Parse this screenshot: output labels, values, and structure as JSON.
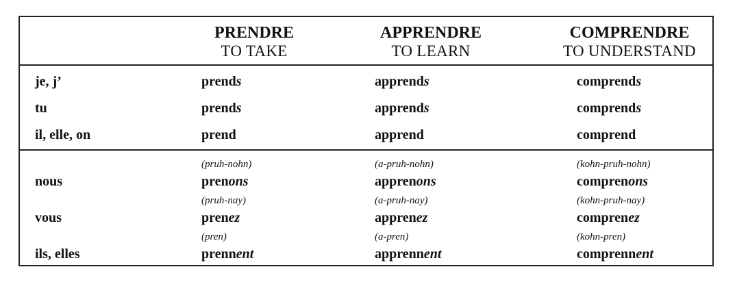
{
  "headers": [
    {
      "verb": "PRENDRE",
      "translation": "TO TAKE"
    },
    {
      "verb": "APPRENDRE",
      "translation": "TO LEARN"
    },
    {
      "verb": "COMPRENDRE",
      "translation": "TO UNDERSTAND"
    }
  ],
  "singular": [
    {
      "subject": "je, j’",
      "forms": [
        {
          "stem": "prend",
          "ending": "s"
        },
        {
          "stem": "apprend",
          "ending": "s"
        },
        {
          "stem": "comprend",
          "ending": "s"
        }
      ]
    },
    {
      "subject": "tu",
      "forms": [
        {
          "stem": "prend",
          "ending": "s"
        },
        {
          "stem": "apprend",
          "ending": "s"
        },
        {
          "stem": "comprend",
          "ending": "s"
        }
      ]
    },
    {
      "subject": "il, elle, on",
      "forms": [
        {
          "stem": "prend",
          "ending": ""
        },
        {
          "stem": "apprend",
          "ending": ""
        },
        {
          "stem": "comprend",
          "ending": ""
        }
      ]
    }
  ],
  "plural": [
    {
      "subject": "nous",
      "pronunciations": [
        "(pruh-nohn)",
        "(a-pruh-nohn)",
        "(kohn-pruh-nohn)"
      ],
      "forms": [
        {
          "stem": "pren",
          "ending": "ons"
        },
        {
          "stem": "appren",
          "ending": "ons"
        },
        {
          "stem": "compren",
          "ending": "ons"
        }
      ]
    },
    {
      "subject": "vous",
      "pronunciations": [
        "(pruh-nay)",
        "(a-pruh-nay)",
        "(kohn-pruh-nay)"
      ],
      "forms": [
        {
          "stem": "pren",
          "ending": "ez"
        },
        {
          "stem": "appren",
          "ending": "ez"
        },
        {
          "stem": "compren",
          "ending": "ez"
        }
      ]
    },
    {
      "subject": "ils, elles",
      "pronunciations": [
        "(pren)",
        "(a-pren)",
        "(kohn-pren)"
      ],
      "forms": [
        {
          "stem": "prenn",
          "ending": "ent"
        },
        {
          "stem": "apprenn",
          "ending": "ent"
        },
        {
          "stem": "comprenn",
          "ending": "ent"
        }
      ]
    }
  ]
}
